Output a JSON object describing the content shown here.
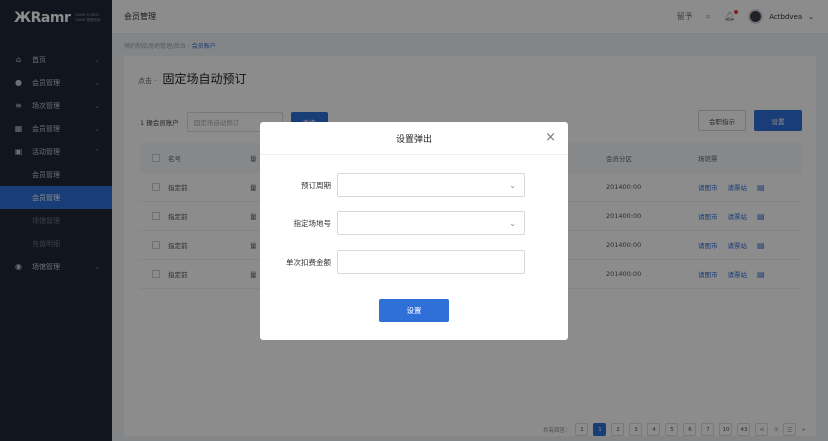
{
  "app": {
    "logo_text": "ЖRamr",
    "logo_sub_1": "RAMR CONGS",
    "logo_sub_2": "RAMR 管理系统"
  },
  "sidebar": {
    "items": [
      {
        "label": "首页",
        "icon": "home-icon",
        "glyph": "⌂"
      },
      {
        "label": "会员管理",
        "icon": "user-icon",
        "glyph": "●"
      },
      {
        "label": "场次管理",
        "icon": "list-icon",
        "glyph": "≡"
      },
      {
        "label": "会员管理",
        "icon": "grid-icon",
        "glyph": "▦"
      },
      {
        "label": "活动管理",
        "icon": "calendar-icon",
        "glyph": "▣"
      }
    ],
    "sub_items": [
      {
        "label": "会员管理"
      },
      {
        "label": "会员管理"
      },
      {
        "label": "场馆管理"
      },
      {
        "label": "充值明细"
      }
    ],
    "last_item": {
      "label": "场馆管理",
      "icon": "location-icon",
      "glyph": "◉"
    }
  },
  "header": {
    "title": "会员管理",
    "help": "留予",
    "username": "Actbdvea"
  },
  "breadcrumb": {
    "path": "预约制品场地管理/后台 ·",
    "current": "会员账户"
  },
  "page": {
    "title_prefix": "点击 ·",
    "title": "固定场自动预订"
  },
  "toolbar": {
    "label": "1 操会员账户",
    "select_placeholder": "固定场自动预订",
    "query_button": "查询",
    "export_button": "会职指示",
    "set_button": "设置"
  },
  "table": {
    "headers": {
      "name": "名号",
      "two": "量",
      "zone": "会员分区",
      "ops": "场馆票"
    },
    "rows": [
      {
        "name": "指定前",
        "two": "量",
        "zone": "201400:00",
        "op1": "请图市",
        "op2": "请票站"
      },
      {
        "name": "指定前",
        "two": "量",
        "zone": "201400:00",
        "op1": "请图市",
        "op2": "请票站"
      },
      {
        "name": "指定前",
        "two": "量",
        "zone": "201400:00",
        "op1": "请图市",
        "op2": "请票站"
      },
      {
        "name": "指定前",
        "two": "量",
        "zone": "201400:00",
        "op1": "请图市",
        "op2": "请票站"
      }
    ]
  },
  "pager": {
    "total": "共有回答：",
    "pages": [
      "1",
      "1",
      "2",
      "3",
      "4",
      "5",
      "6",
      "7",
      "10",
      "43",
      "<",
      "①",
      "三",
      "+"
    ]
  },
  "modal": {
    "title": "设置弹出",
    "close": "×",
    "fields": [
      {
        "label": "预订周期",
        "type": "select"
      },
      {
        "label": "指定场地号",
        "type": "select"
      },
      {
        "label": "单次扣费金额",
        "type": "input"
      }
    ],
    "submit": "设置"
  },
  "colors": {
    "primary": "#2f6fd8",
    "sidebar_bg": "#1f2838",
    "overlay": "rgba(0,0,0,0.45)"
  }
}
